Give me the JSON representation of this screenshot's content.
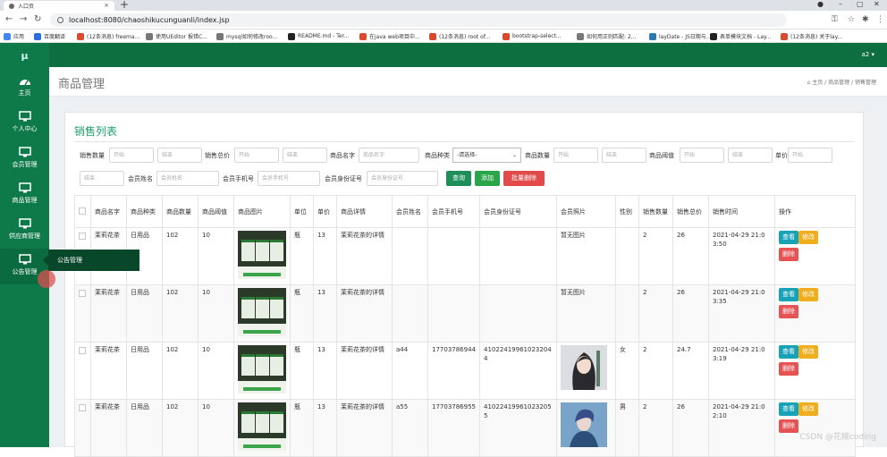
{
  "browser": {
    "tab_title": "入口页",
    "url": "localhost:8080/chaoshikucunguanli/index.jsp",
    "bookmarks": [
      {
        "label": "应用",
        "color": "#4285f4"
      },
      {
        "label": "百度翻译",
        "color": "#2c6de0"
      },
      {
        "label": "(12条消息) freema...",
        "color": "#d84a2b"
      },
      {
        "label": "使用UEditor 报错C...",
        "color": "#777777"
      },
      {
        "label": "mysql如何修改roo...",
        "color": "#777777"
      },
      {
        "label": "README.md - Ter...",
        "color": "#222222"
      },
      {
        "label": "在java web项目中...",
        "color": "#d84a2b"
      },
      {
        "label": "(12条消息) root of...",
        "color": "#d84a2b"
      },
      {
        "label": "bootstrap-select...",
        "color": "#d84a2b"
      },
      {
        "label": "如何用正则匹配: 2...",
        "color": "#777777"
      },
      {
        "label": "layDate - JS日期与...",
        "color": "#2a7ab0"
      },
      {
        "label": "表单模块文档 - Lay...",
        "color": "#222222"
      },
      {
        "label": "(12条消息) 关于lay...",
        "color": "#d84a2b"
      }
    ]
  },
  "app": {
    "brand": "μ",
    "user": "a2 ▾",
    "page_title": "商品管理",
    "breadcrumb": {
      "home": "主页",
      "section": "商品管理",
      "current": "销售管理"
    },
    "nav": [
      {
        "label": "主页",
        "icon": "dashboard-icon"
      },
      {
        "label": "个人中心",
        "icon": "monitor-icon"
      },
      {
        "label": "会员管理",
        "icon": "monitor-icon"
      },
      {
        "label": "商品管理",
        "icon": "monitor-icon"
      },
      {
        "label": "供应商管理",
        "icon": "monitor-icon"
      },
      {
        "label": "公告管理",
        "icon": "monitor-icon"
      }
    ],
    "tooltip": "公告管理"
  },
  "list": {
    "title": "销售列表",
    "filters": {
      "sale_qty": "销售数量",
      "sale_total": "销售总价",
      "product_name": "商品名字",
      "product_type": "商品种类",
      "product_qty": "商品数量",
      "product_threshold": "商品阈值",
      "unit_price": "单价",
      "member_name": "会员姓名",
      "member_phone": "会员手机号",
      "member_id": "会员身份证号",
      "ph_start": "开始",
      "ph_end": "结束",
      "ph_product_name": "商品名字",
      "select_default": "-请选择-",
      "ph_member_name": "会员姓名",
      "ph_member_phone": "会员手机号",
      "ph_member_id": "会员身份证号"
    },
    "buttons": {
      "search": "查询",
      "add": "添加",
      "batch_delete": "批量删除"
    },
    "columns": [
      "商品名字",
      "商品种类",
      "商品数量",
      "商品阈值",
      "商品图片",
      "单位",
      "单价",
      "商品详情",
      "会员姓名",
      "会员手机号",
      "会员身份证号",
      "会员照片",
      "性别",
      "销售数量",
      "销售总价",
      "销售时间",
      "操作"
    ],
    "row_actions": {
      "view": "查看",
      "edit": "修改",
      "delete": "删除"
    },
    "rows": [
      {
        "name": "茉莉花茶",
        "type": "日用品",
        "qty": "102",
        "threshold": "10",
        "unit": "瓶",
        "price": "13",
        "detail": "茉莉花茶的详情",
        "member": "",
        "phone": "",
        "idcard": "",
        "photo": "暂无图片",
        "gender": "",
        "sale_qty": "2",
        "sale_total": "26",
        "time": "2021-04-29 21:03:50"
      },
      {
        "name": "茉莉花茶",
        "type": "日用品",
        "qty": "102",
        "threshold": "10",
        "unit": "瓶",
        "price": "13",
        "detail": "茉莉花茶的详情",
        "member": "",
        "phone": "",
        "idcard": "",
        "photo": "暂无图片",
        "gender": "",
        "sale_qty": "2",
        "sale_total": "26",
        "time": "2021-04-29 21:03:35"
      },
      {
        "name": "茉莉花茶",
        "type": "日用品",
        "qty": "102",
        "threshold": "10",
        "unit": "瓶",
        "price": "13",
        "detail": "茉莉花茶的详情",
        "member": "a44",
        "phone": "17703786944",
        "idcard": "410224199610232044",
        "photo": "",
        "gender": "女",
        "sale_qty": "2",
        "sale_total": "24.7",
        "time": "2021-04-29 21:03:19"
      },
      {
        "name": "茉莉花茶",
        "type": "日用品",
        "qty": "102",
        "threshold": "10",
        "unit": "瓶",
        "price": "13",
        "detail": "茉莉花茶的详情",
        "member": "a55",
        "phone": "17703786955",
        "idcard": "410224199610232055",
        "photo": "",
        "gender": "男",
        "sale_qty": "2",
        "sale_total": "26",
        "time": "2021-04-29 21:02:10"
      }
    ]
  },
  "watermark": "CSDN @花椒coding"
}
